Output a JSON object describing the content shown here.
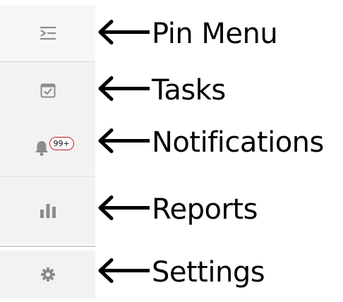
{
  "nav_rail": {
    "items": [
      {
        "id": "pin-menu",
        "icon": "pin-menu-icon"
      },
      {
        "id": "tasks",
        "icon": "tasks-icon"
      },
      {
        "id": "notifications",
        "icon": "bell-icon",
        "badge": "99+"
      },
      {
        "id": "reports",
        "icon": "bar-chart-icon"
      },
      {
        "id": "settings",
        "icon": "gear-icon"
      }
    ]
  },
  "callouts": [
    {
      "label": "Pin Menu"
    },
    {
      "label": "Tasks"
    },
    {
      "label": "Notifications"
    },
    {
      "label": "Reports"
    },
    {
      "label": "Settings"
    }
  ],
  "colors": {
    "rail_background": "#f2f2f2",
    "icon": "#8c8c8c",
    "badge_border": "#c41d1d",
    "text": "#000000"
  }
}
